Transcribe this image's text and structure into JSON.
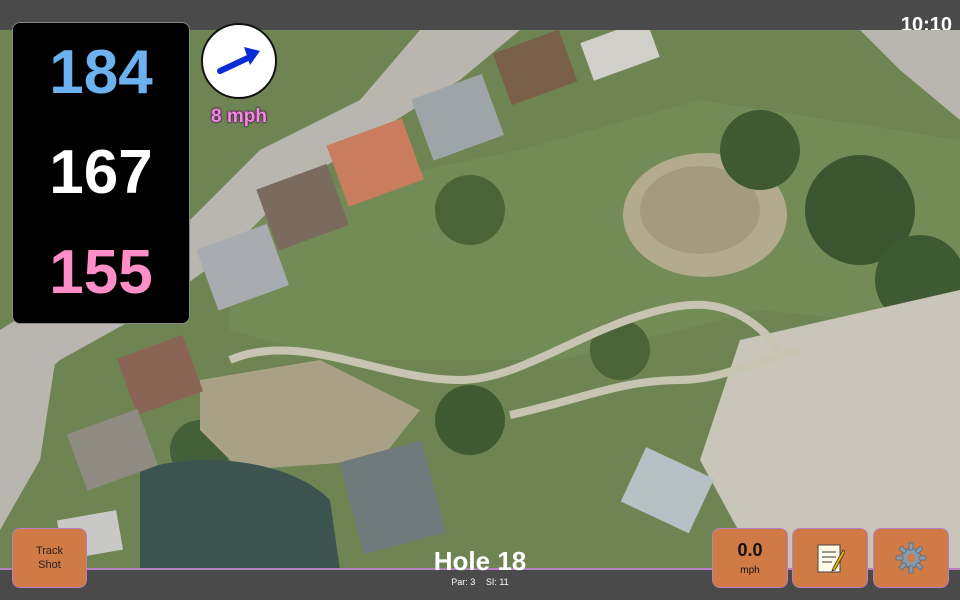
{
  "status_bar": {
    "time": "10:10"
  },
  "distances": {
    "back": "184",
    "middle": "167",
    "front": "155"
  },
  "wind": {
    "speed": "8 mph",
    "icon": "wind-arrow-icon"
  },
  "hole": {
    "title": "Hole 18",
    "par": "Par: 3",
    "si": "SI: 11"
  },
  "buttons": {
    "track_shot": {
      "line1": "Track",
      "line2": "Shot"
    },
    "speed": {
      "value": "0.0",
      "unit": "mph"
    },
    "notes": {
      "icon": "notes-icon"
    },
    "settings": {
      "icon": "gear-icon"
    }
  },
  "colors": {
    "back_distance": "#6cb2f0",
    "middle_distance": "#ffffff",
    "front_distance": "#ff8ec8",
    "button": "#d07a45",
    "accent_border": "#b57fc1",
    "wind_text": "#f08de0"
  }
}
